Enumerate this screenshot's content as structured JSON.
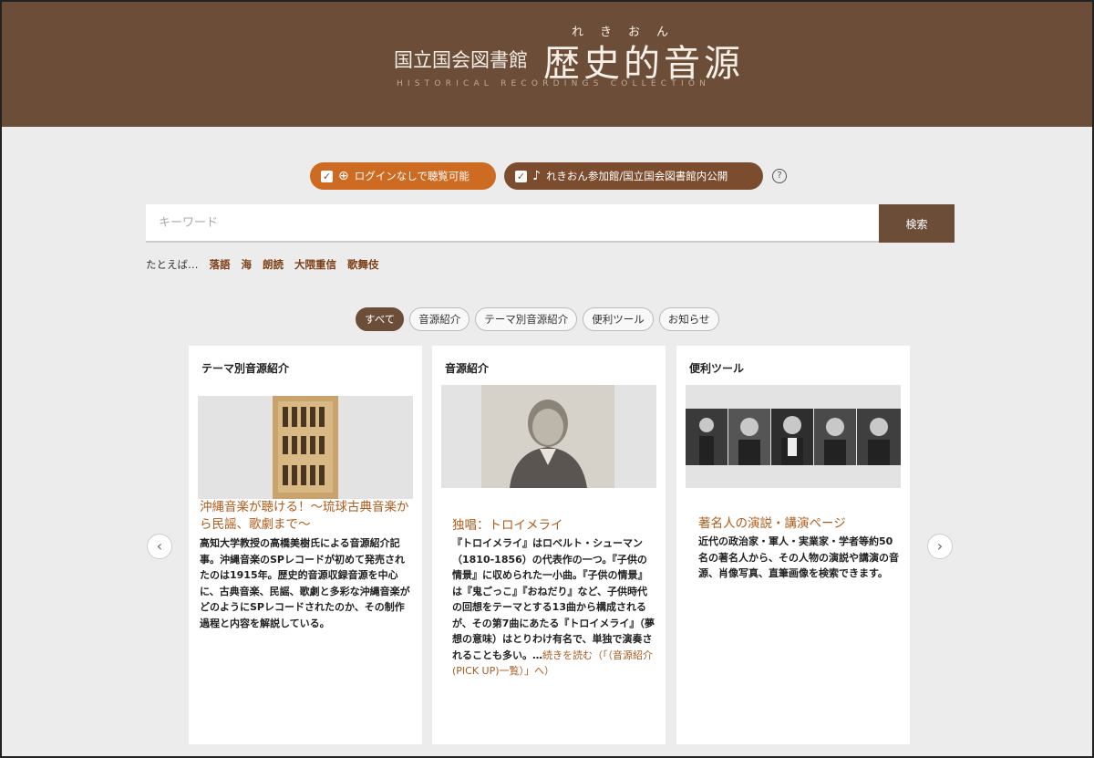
{
  "header": {
    "org_name": "国立国会図書館",
    "title": "歴史的音源",
    "ruby": "れきおん",
    "subtitle": "HISTORICAL RECORDINGS COLLECTION"
  },
  "filters": [
    {
      "label": "ログインなしで聴覧可能",
      "checked": true,
      "icon": "globe-icon"
    },
    {
      "label": "れきおん参加館/国立国会図書館内公開",
      "checked": true,
      "icon": "gramophone-icon"
    }
  ],
  "search": {
    "placeholder": "キーワード",
    "button_label": "検索",
    "examples_prefix": "たとえば…",
    "examples": [
      "落語",
      "海",
      "朗読",
      "大隈重信",
      "歌舞伎"
    ]
  },
  "tabs": [
    {
      "label": "すべて",
      "active": true
    },
    {
      "label": "音源紹介",
      "active": false
    },
    {
      "label": "テーマ別音源紹介",
      "active": false
    },
    {
      "label": "便利ツール",
      "active": false
    },
    {
      "label": "お知らせ",
      "active": false
    }
  ],
  "cards": [
    {
      "category": "テーマ別音源紹介",
      "title": "沖縄音楽が聴ける！～琉球古典音楽から民謡、歌劇まで～",
      "body": "高知大学教授の高橋美樹氏による音源紹介記事。沖縄音楽のSPレコードが初めて発売されたのは1915年。歴史的音源収録音源を中心に、古典音楽、民謡、歌劇と多彩な沖縄音楽がどのようにSPレコードされたのか、その制作過程と内容を解説している。"
    },
    {
      "category": "音源紹介",
      "title": "独唱：トロイメライ",
      "body": "『トロイメライ』はロベルト・シューマン（1810-1856）の代表作の一つ。『子供の情景』に収められた一小曲。『子供の情景』は『鬼ごっこ』『おねだり』など、子供時代の回想をテーマとする13曲から構成されるが、その第7曲にあたる『トロイメライ』（夢想の意味）はとりわけ有名で、単独で演奏されることも多い。…",
      "read_more": "続きを読む（「（音源紹介(PICK UP)一覧）」へ）"
    },
    {
      "category": "便利ツール",
      "title": "著名人の演説・講演ページ",
      "body": "近代の政治家・軍人・実業家・学者等約50名の著名人から、その人物の演説や講演の音源、肖像写真、直筆画像を検索できます。"
    }
  ],
  "nav": {
    "prev": "‹",
    "next": "›"
  },
  "colors": {
    "header_bg": "#6b4d38",
    "accent_orange": "#cd6b22",
    "accent_brown": "#7b4c2e",
    "title_text": "#b15b1a"
  }
}
